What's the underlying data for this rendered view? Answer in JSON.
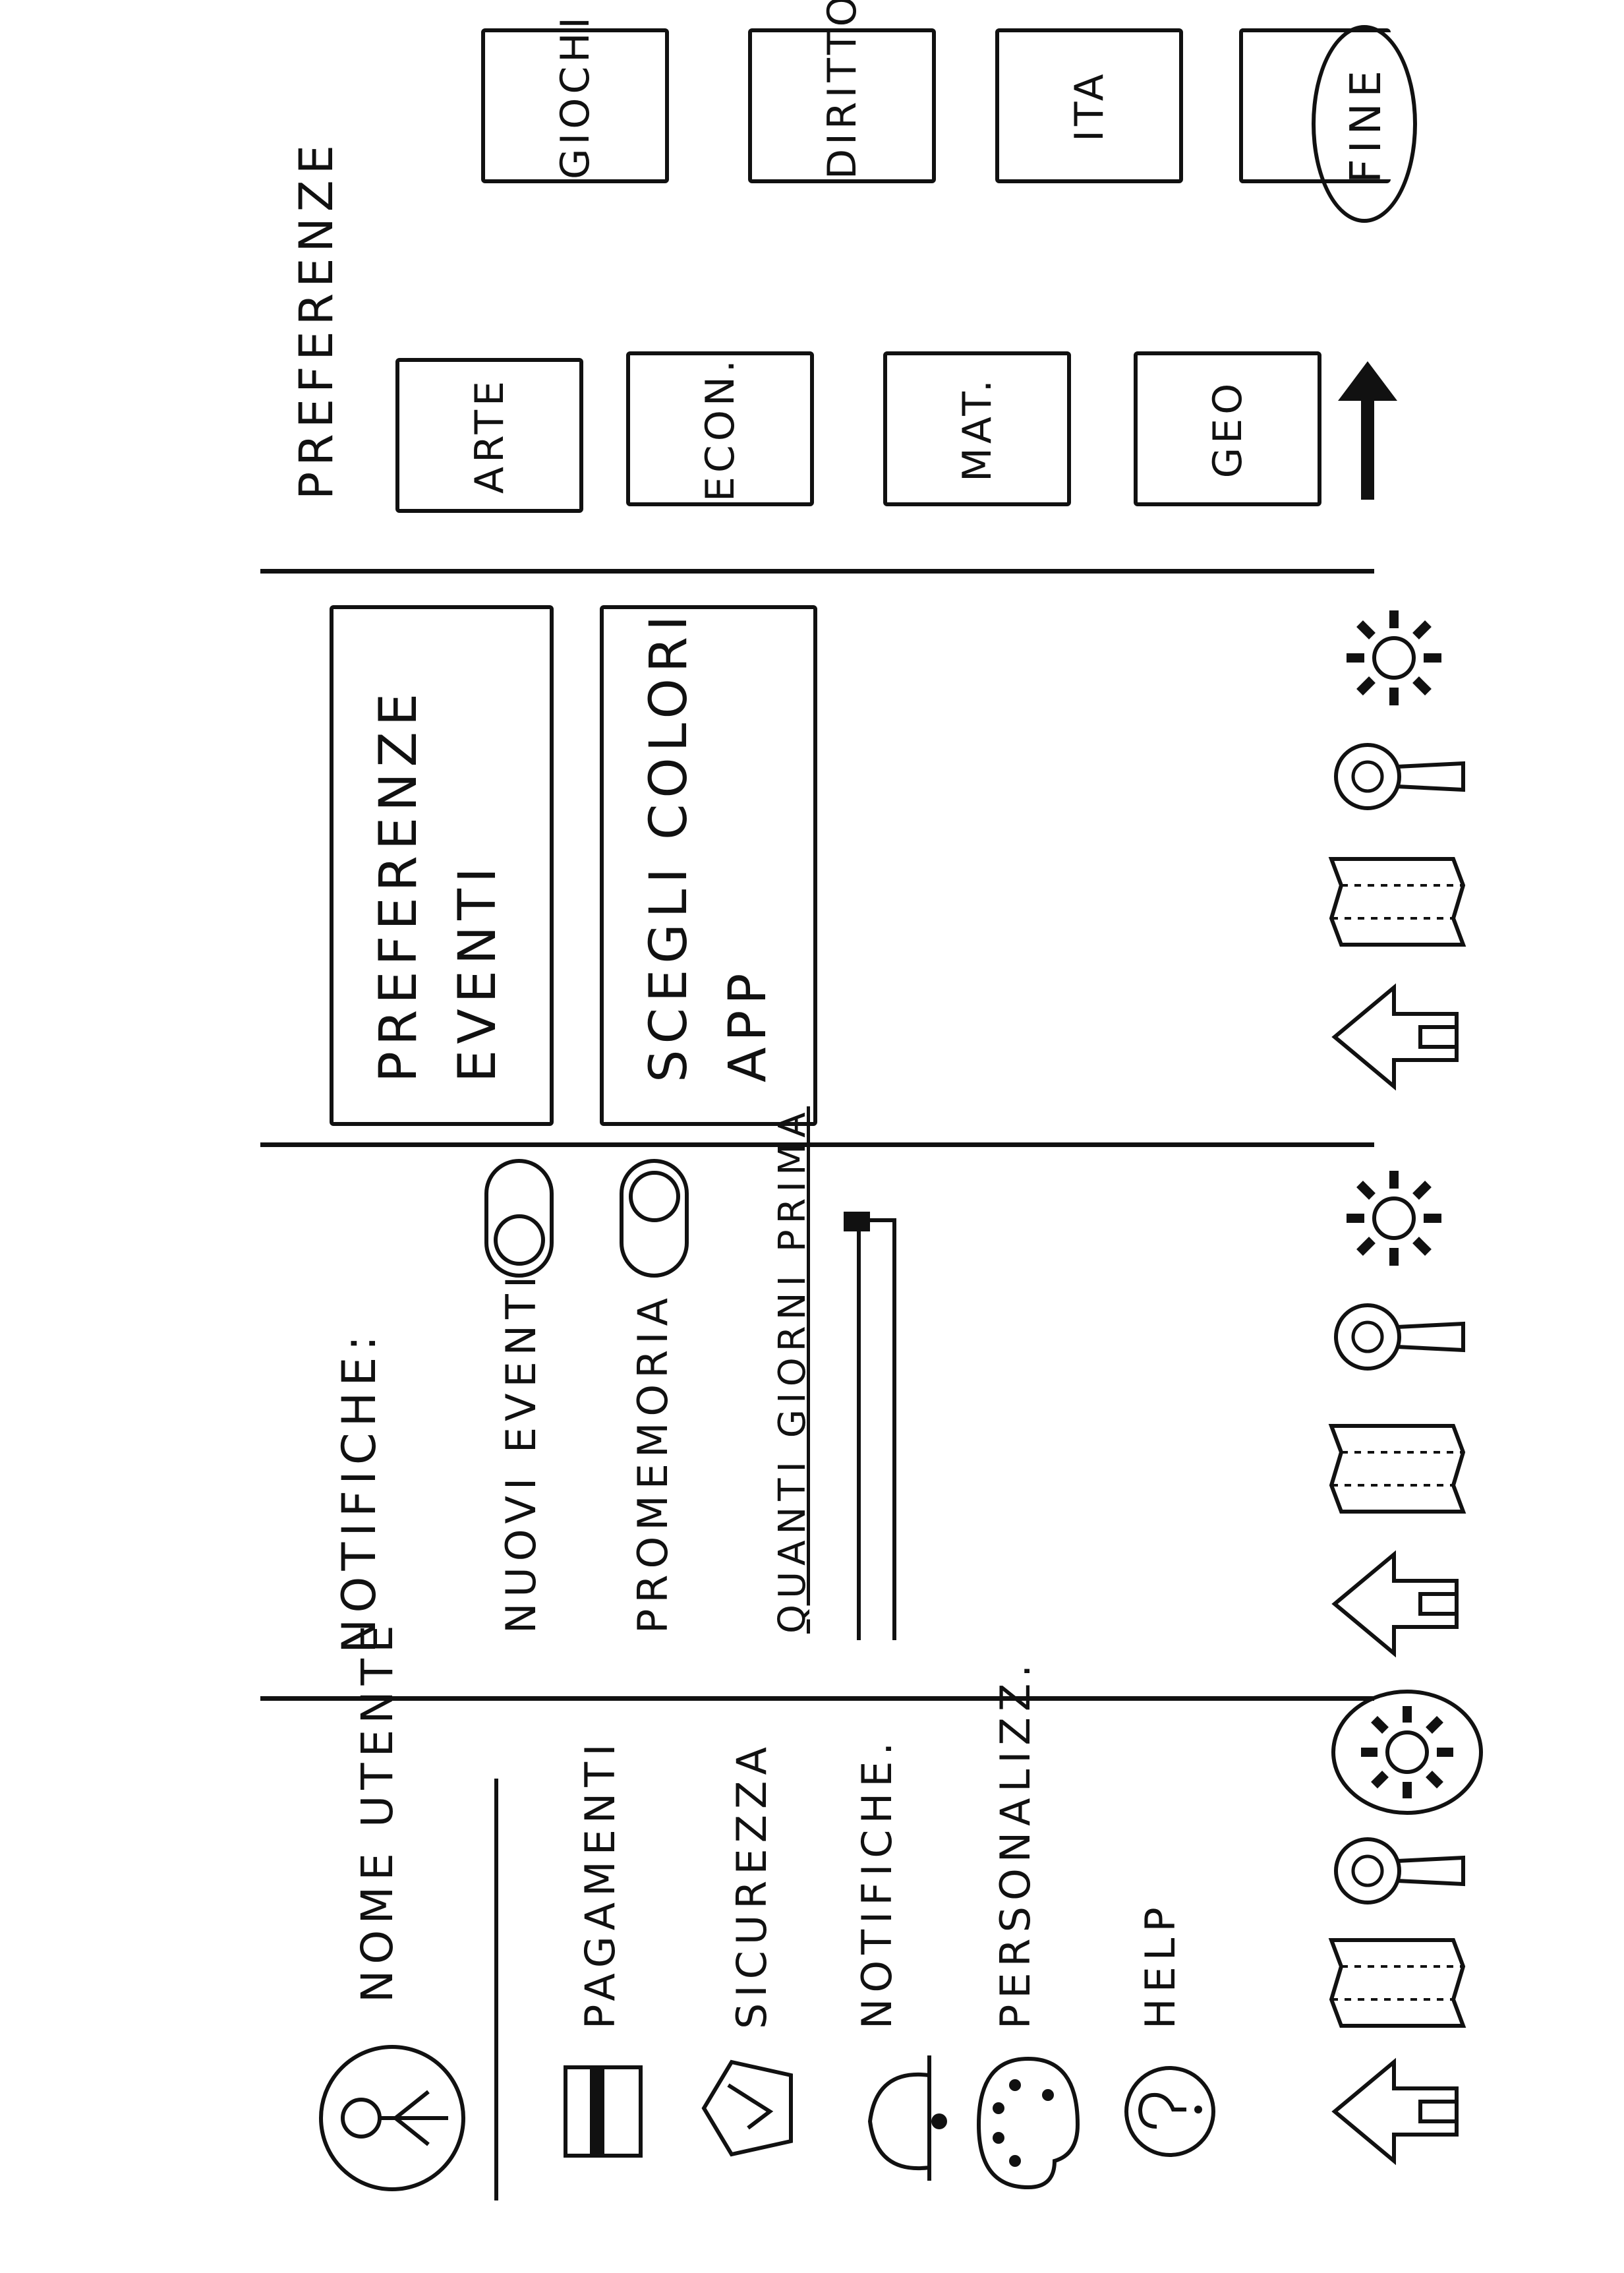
{
  "screens": {
    "profile_menu": {
      "user_name": "NOME UTENTE",
      "items": [
        {
          "label": "PAGAMENTI",
          "icon": "credit-card-icon"
        },
        {
          "label": "SICUREZZA",
          "icon": "shield-check-icon"
        },
        {
          "label": "NOTIFICHE.",
          "icon": "bell-icon"
        },
        {
          "label": "PERSONALIZZ.",
          "icon": "palette-icon"
        },
        {
          "label": "HELP",
          "icon": "help-icon"
        }
      ]
    },
    "notifications": {
      "title": "NOTIFICHE:",
      "toggles": [
        {
          "label": "NUOVI EVENTI"
        },
        {
          "label": "PROMEMORIA"
        }
      ],
      "days_before_label": "QUANTI GIORNI PRIMA"
    },
    "personalize": {
      "buttons": [
        {
          "line1": "PREFERENZE",
          "line2": "EVENTI"
        },
        {
          "line1": "SCEGLI COLORI",
          "line2": "APP"
        }
      ]
    },
    "preferences": {
      "title": "PREFERENZE",
      "categories": [
        "GIOCHI",
        "ARTE",
        "DIRITTO",
        "ECON.",
        "ITA",
        "MAT.",
        "GEO"
      ],
      "done_label": "FINE"
    }
  },
  "nav_icons": [
    "home-icon",
    "map-icon",
    "search-icon",
    "settings-icon"
  ]
}
